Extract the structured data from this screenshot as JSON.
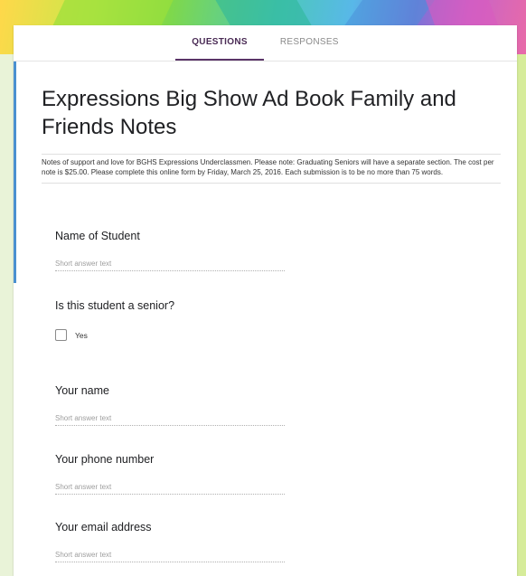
{
  "tabs": [
    {
      "label": "QUESTIONS"
    },
    {
      "label": "RESPONSES"
    }
  ],
  "form": {
    "title": "Expressions Big Show Ad Book Family and Friends Notes",
    "description": "Notes of support and love for BGHS Expressions Underclassmen.  Please note: Graduating Seniors will have a separate section.  The cost per note is $25.00.  Please complete this online form by Friday, March 25, 2016.  Each submission is to be no more than 75 words."
  },
  "questions": [
    {
      "label": "Name of Student",
      "placeholder": "Short answer text"
    },
    {
      "label": "Is this student a senior?",
      "option": "Yes"
    },
    {
      "label": "Your name",
      "placeholder": "Short answer text"
    },
    {
      "label": "Your phone number",
      "placeholder": "Short answer text"
    },
    {
      "label": "Your email address",
      "placeholder": "Short answer text"
    }
  ],
  "colors": {
    "accent_tab": "#5a3468",
    "left_bar": "#4a90d0",
    "background": "#e9f3d8"
  }
}
